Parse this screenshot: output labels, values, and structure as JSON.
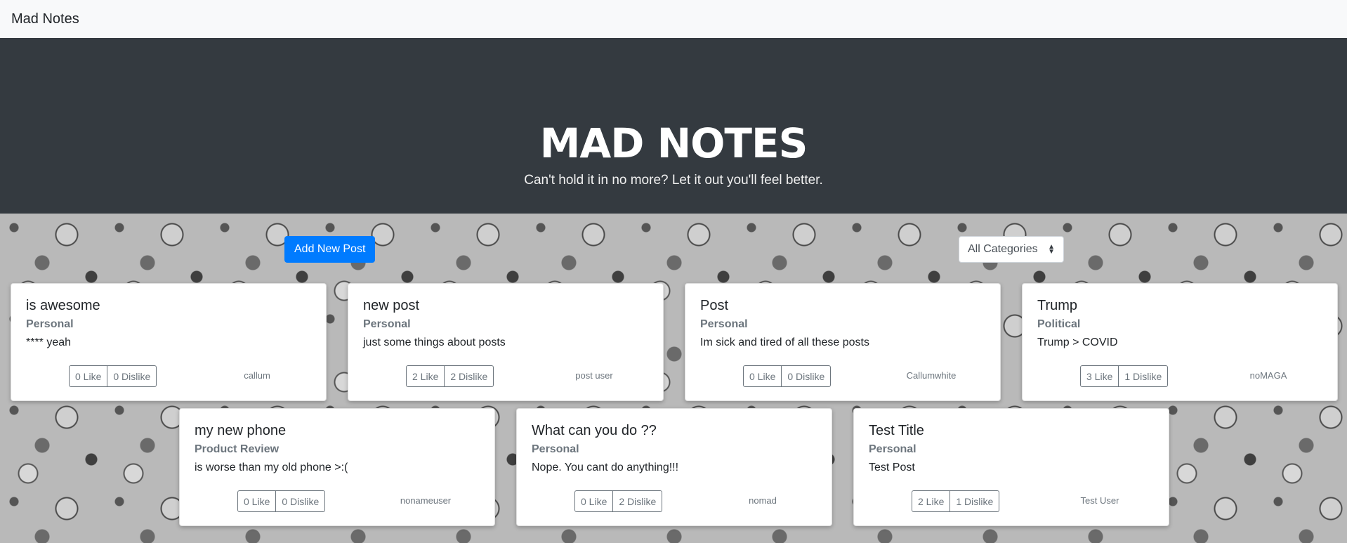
{
  "navbar": {
    "brand": "Mad Notes"
  },
  "hero": {
    "title": "MAD NOTES",
    "subtitle": "Can't hold it in no more? Let it out you'll feel better."
  },
  "toolbar": {
    "add_label": "Add New Post",
    "category_selected": "All Categories"
  },
  "posts": [
    {
      "title": "is awesome",
      "category": "Personal",
      "body": "**** yeah",
      "like": "0 Like",
      "dislike": "0 Dislike",
      "author": "callum"
    },
    {
      "title": "new post",
      "category": "Personal",
      "body": "just some things about posts",
      "like": "2 Like",
      "dislike": "2 Dislike",
      "author": "post user"
    },
    {
      "title": "Post",
      "category": "Personal",
      "body": "Im sick and tired of all these posts",
      "like": "0 Like",
      "dislike": "0 Dislike",
      "author": "Callumwhite"
    },
    {
      "title": "Trump",
      "category": "Political",
      "body": "Trump > COVID",
      "like": "3 Like",
      "dislike": "1 Dislike",
      "author": "noMAGA"
    },
    {
      "title": "my new phone",
      "category": "Product Review",
      "body": "is worse than my old phone >:(",
      "like": "0 Like",
      "dislike": "0 Dislike",
      "author": "nonameuser"
    },
    {
      "title": "What can you do ??",
      "category": "Personal",
      "body": "Nope. You cant do anything!!!",
      "like": "0 Like",
      "dislike": "2 Dislike",
      "author": "nomad"
    },
    {
      "title": "Test Title",
      "category": "Personal",
      "body": "Test Post",
      "like": "2 Like",
      "dislike": "1 Dislike",
      "author": "Test User"
    }
  ]
}
